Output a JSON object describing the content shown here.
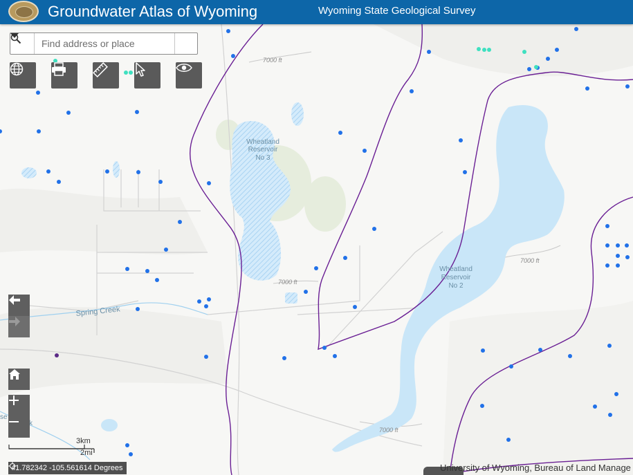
{
  "header": {
    "title": "Groundwater Atlas of Wyoming",
    "agency": "Wyoming State Geological Survey"
  },
  "search": {
    "placeholder": "Find address or place"
  },
  "toolbar": {
    "buttons": [
      "globe-icon",
      "printer-icon",
      "ruler-icon",
      "pointer-icon",
      "eye-icon"
    ]
  },
  "map_labels": {
    "reservoir_3": [
      "Wheatland",
      "Reservoir",
      "No 3"
    ],
    "reservoir_2": [
      "Wheatland",
      "Reservoir",
      "No 2"
    ],
    "creek": "Spring Creek",
    "creek_partial": [
      "se",
      "k"
    ],
    "contour": "7000 ft"
  },
  "scale": {
    "km": "3km",
    "mi": "2mi"
  },
  "coordinates": "41.782342 -105.561614 Degrees",
  "attribution": "University of Wyoming, Bureau of Land Manage",
  "colors": {
    "header": "#0d66a8",
    "water": "#c9e6f8",
    "well_points": "#2171e8",
    "boundary": "#6a1f94",
    "tool_button": "#5a5a5a"
  }
}
